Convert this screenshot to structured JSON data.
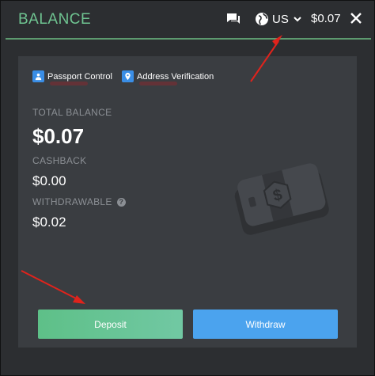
{
  "header": {
    "title": "BALANCE",
    "region": "US",
    "balance": "$0.07"
  },
  "verification": {
    "passport_label": "Passport Control",
    "address_label": "Address Verification"
  },
  "balances": {
    "total_label": "TOTAL BALANCE",
    "total_value": "$0.07",
    "cashback_label": "CASHBACK",
    "cashback_value": "$0.00",
    "withdrawable_label": "WITHDRAWABLE",
    "withdrawable_value": "$0.02"
  },
  "actions": {
    "deposit_label": "Deposit",
    "withdraw_label": "Withdraw"
  },
  "icons": {
    "chat": "chat-icon",
    "globe": "globe-icon",
    "chevron": "chevron-down-icon",
    "close": "close-icon",
    "passport": "passport-icon",
    "location": "location-pin-icon",
    "help": "help-icon",
    "cash": "cash-icon"
  },
  "colors": {
    "title": "#6fc491",
    "deposit": "#5ec088",
    "withdraw": "#4ba3ee",
    "annotation_arrow": "#e0231c"
  }
}
